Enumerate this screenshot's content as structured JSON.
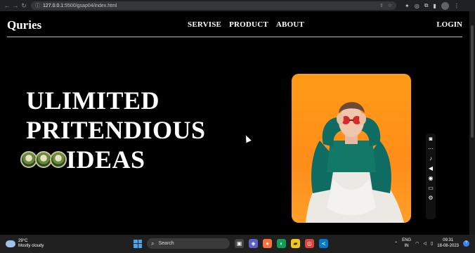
{
  "browser": {
    "url_host": "127.0.0.1",
    "url_path": ":5500/gsap04/index.html"
  },
  "site": {
    "brand": "Quries",
    "menu": [
      "SERVISE",
      "PRODUCT",
      "ABOUT"
    ],
    "login": "LOGIN"
  },
  "hero": {
    "line1": "ULIMITED",
    "line2": "PRITENDIOUS",
    "line3": "IDEAS"
  },
  "taskbar": {
    "temperature": "29°C",
    "weather": "Mostly cloudy",
    "search_label": "Search",
    "lang_top": "ENG",
    "lang_bottom": "IN",
    "time": "09:31",
    "date": "18-08-2023"
  },
  "colors": {
    "accent_orange": "#ff9b17",
    "windows_blue": "#3ea7f2"
  }
}
